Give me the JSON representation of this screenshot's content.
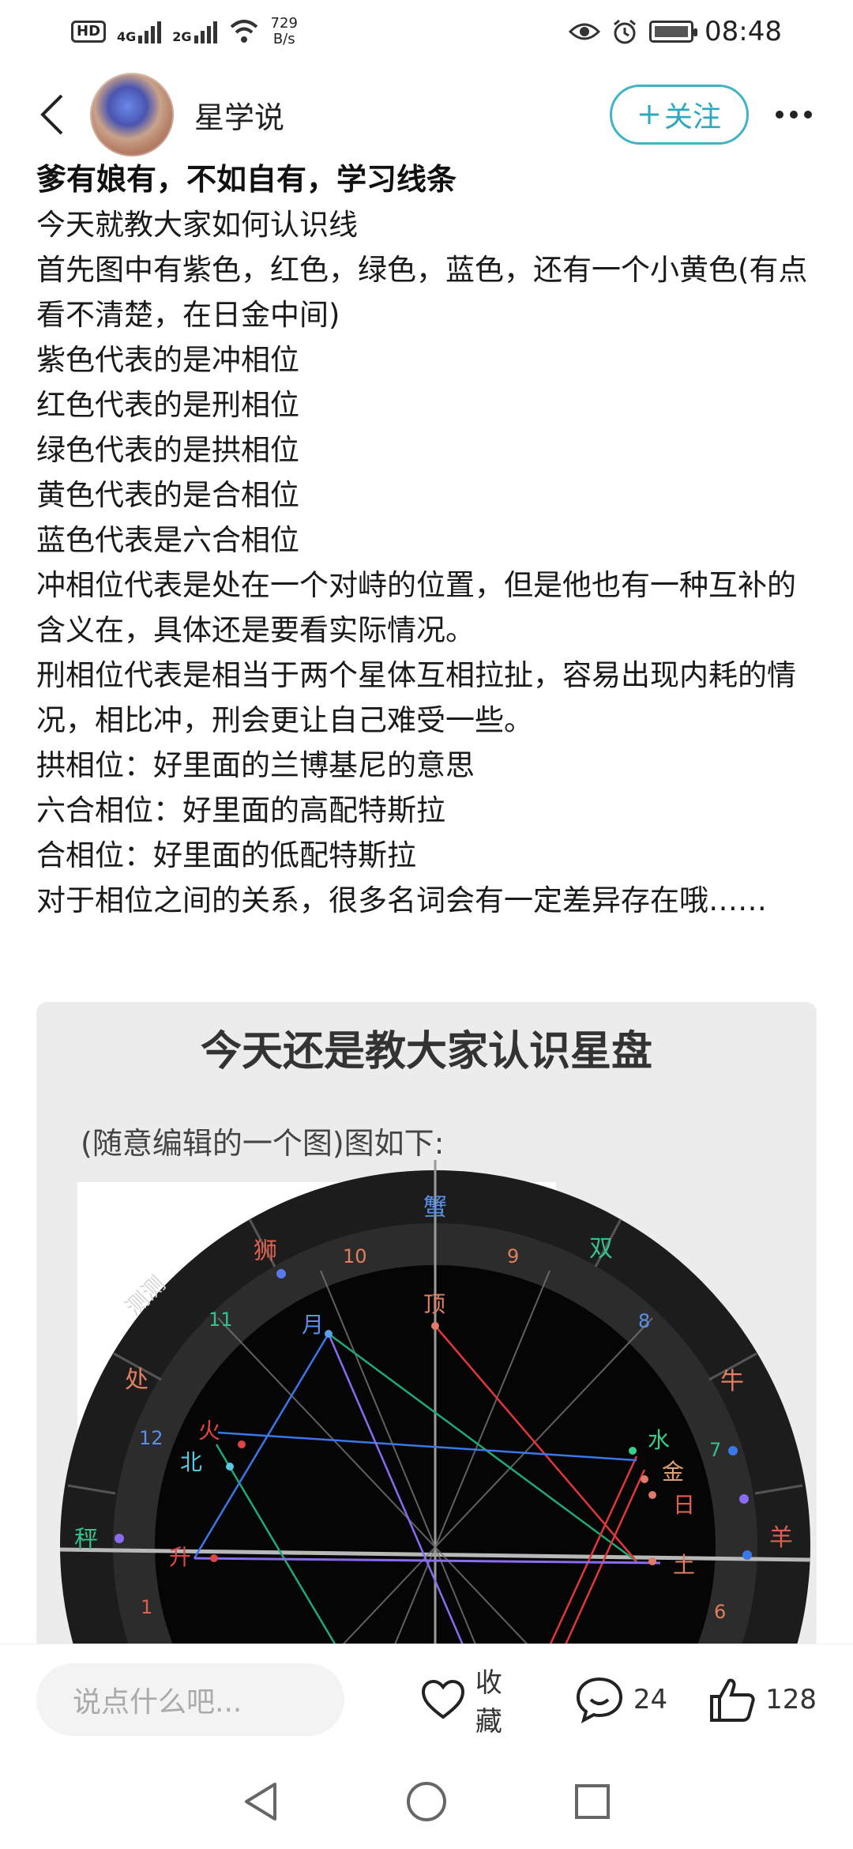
{
  "status_bar": {
    "hd_label": "HD",
    "sim1_network": "4G",
    "sim2_network": "2G",
    "net_speed_value": "729",
    "net_speed_unit": "B/s",
    "time": "08:48",
    "icons": [
      "eye-icon",
      "alarm-icon",
      "battery-icon",
      "wifi-icon",
      "signal-icon"
    ]
  },
  "header": {
    "author_name": "星学说",
    "follow_label": "关注",
    "follow_icon": "plus-icon",
    "back_icon": "chevron-left-icon",
    "more_icon": "more-dots-icon",
    "accent_color": "#2aa8bd"
  },
  "post": {
    "title": "爹有娘有，不如自有，学习线条",
    "paragraphs": [
      "今天就教大家如何认识线",
      "首先图中有紫色，红色，绿色，蓝色，还有一个小黄色(有点看不清楚，在日金中间)",
      "紫色代表的是冲相位",
      "红色代表的是刑相位",
      "绿色代表的是拱相位",
      "黄色代表的是合相位",
      "蓝色代表是六合相位",
      "冲相位代表是处在一个对峙的位置，但是他也有一种互补的含义在，具体还是要看实际情况。",
      "刑相位代表是相当于两个星体互相拉扯，容易出现内耗的情况，相比冲，刑会更让自己难受一些。",
      "拱相位：好里面的兰博基尼的意思",
      "六合相位：好里面的高配特斯拉",
      "合相位：好里面的低配特斯拉",
      "对于相位之间的关系，很多名词会有一定差异存在哦……"
    ]
  },
  "image": {
    "title": "今天还是教大家认识星盘",
    "subtitle": "(随意编辑的一个图)图如下:",
    "watermark": "测测",
    "signs": {
      "xie": "蟹",
      "shi": "狮",
      "shuang": "双",
      "chu": "处",
      "niu": "牛",
      "cheng": "秤",
      "yang": "羊"
    },
    "houses": [
      "10",
      "9",
      "11",
      "8",
      "12",
      "7",
      "1",
      "6"
    ],
    "planets": {
      "ding": "顶",
      "yue": "月",
      "huo": "火",
      "bei": "北",
      "sheng": "升",
      "shui": "水",
      "jin": "金",
      "ri": "日",
      "tu": "土"
    }
  },
  "bottom_bar": {
    "comment_placeholder": "说点什么吧...",
    "favorite_label": "收藏",
    "comment_count": "24",
    "like_count": "128",
    "icons": [
      "heart-icon",
      "comment-bubble-icon",
      "thumbs-up-icon"
    ]
  },
  "nav_bar": {
    "icons": [
      "nav-back-icon",
      "nav-home-icon",
      "nav-recents-icon"
    ]
  }
}
